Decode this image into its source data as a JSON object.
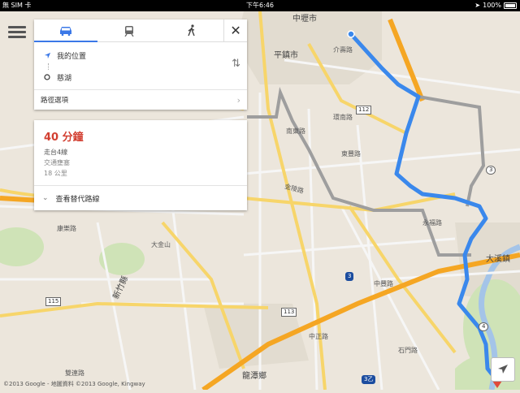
{
  "status_bar": {
    "carrier": "無 SIM 卡",
    "time": "下午6:46",
    "battery": "100%"
  },
  "menu": {
    "icon": "hamburger-menu-icon"
  },
  "directions": {
    "modes": [
      {
        "name": "driving",
        "icon": "car-icon",
        "active": true
      },
      {
        "name": "transit",
        "icon": "train-icon",
        "active": false
      },
      {
        "name": "walking",
        "icon": "walk-icon",
        "active": false
      }
    ],
    "close_icon": "close-icon",
    "origin": "我的位置",
    "destination": "慈湖",
    "route_options_label": "路徑選項"
  },
  "route_card": {
    "duration": "40 分鐘",
    "via": "走台4線",
    "traffic": "交通壅塞",
    "distance": "18 公里",
    "alternatives_label": "查看替代路線"
  },
  "map": {
    "labels": {
      "zhongli": "中壢市",
      "pingzhen": "平鎮市",
      "daxi": "大溪鎮",
      "longtan": "龍潭鄉",
      "xinzhu": "新竹縣",
      "dajin": "大金山",
      "r_shengyang": "南東路",
      "r_huanhe": "環南路",
      "r_dongfeng": "東豐路",
      "r_jinling": "金陵路",
      "r_yongfu": "永福路",
      "r_jieshou": "介壽路",
      "r_zhongfeng": "中豐路",
      "r_shijin": "石門路",
      "r_zhongzheng": "中正路",
      "r_shuangtan": "雙連路",
      "r_kangle": "康樂路"
    },
    "shields": {
      "h112": "112",
      "h113": "113",
      "h115": "115",
      "h3": "3",
      "h4": "4",
      "n3": "3",
      "n3z": "3乙"
    },
    "route_color": "#3a88ec",
    "alt_route_color": "#9e9e9e"
  },
  "copyright": "©2013 Google - 地圖資料 ©2013 Google, Kingway",
  "locate_icon": "location-arrow-icon"
}
